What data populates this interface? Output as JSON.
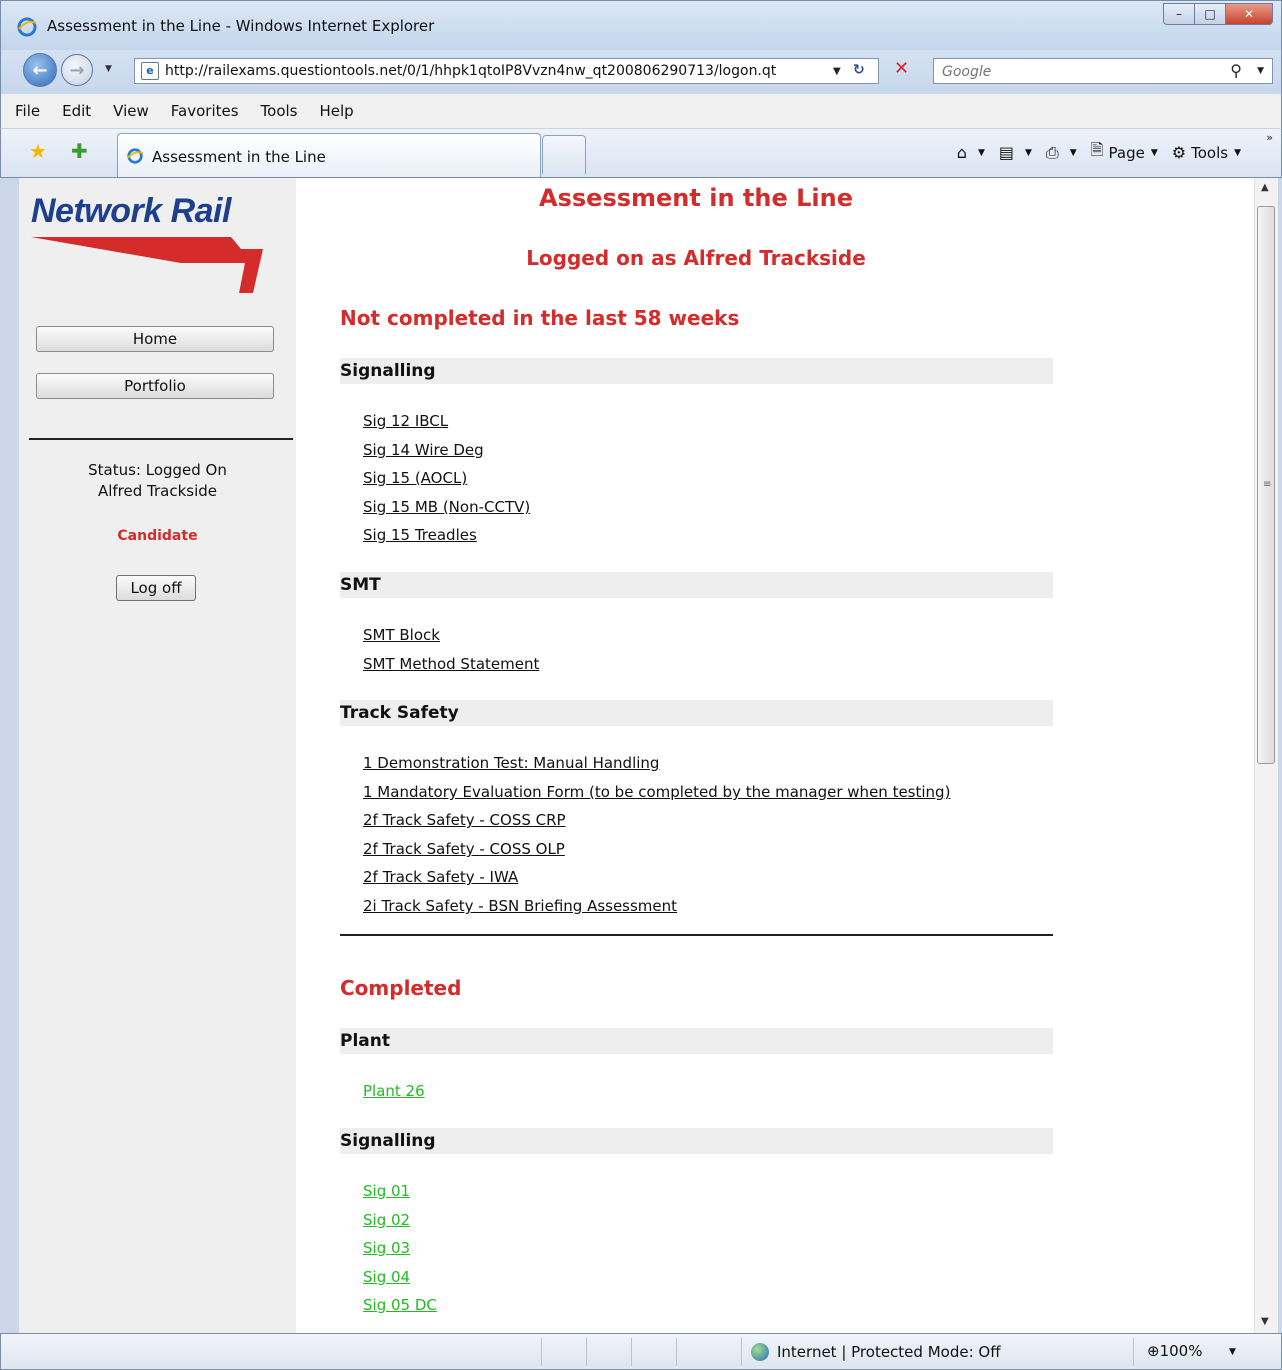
{
  "window": {
    "title": "Assessment in the Line - Windows Internet Explorer",
    "minimize_icon": "minimize-icon",
    "maximize_icon": "maximize-icon",
    "close_icon": "close-icon"
  },
  "address_bar": {
    "url": "http://railexams.questiontools.net/0/1/hhpk1qtoIP8Vvzn4nw_qt200806290713/logon.qt",
    "search_placeholder": "Google"
  },
  "menu": [
    "File",
    "Edit",
    "View",
    "Favorites",
    "Tools",
    "Help"
  ],
  "tab": {
    "label": "Assessment in the Line"
  },
  "command_bar": {
    "page_label": "Page",
    "tools_label": "Tools"
  },
  "sidebar": {
    "logo_text": "Network Rail",
    "home_label": "Home",
    "portfolio_label": "Portfolio",
    "status_line1": "Status: Logged On",
    "status_line2": "Alfred Trackside",
    "role": "Candidate",
    "logoff_label": "Log off"
  },
  "main": {
    "title": "Assessment in the Line",
    "logged_on": "Logged on as Alfred Trackside",
    "not_completed_heading": "Not completed in the last 58 weeks",
    "not_completed": [
      {
        "category": "Signalling",
        "items": [
          "Sig 12 IBCL",
          "Sig 14 Wire Deg",
          "Sig 15 (AOCL)",
          "Sig 15 MB (Non-CCTV)",
          "Sig 15 Treadles"
        ]
      },
      {
        "category": "SMT",
        "items": [
          "SMT Block",
          "SMT Method Statement"
        ]
      },
      {
        "category": "Track Safety",
        "items": [
          "1 Demonstration Test: Manual Handling",
          "1 Mandatory Evaluation Form (to be completed by the manager when testing)",
          "2f Track Safety - COSS CRP",
          "2f Track Safety - COSS OLP",
          "2f Track Safety - IWA",
          "2i Track Safety - BSN Briefing Assessment"
        ]
      }
    ],
    "completed_heading": "Completed",
    "completed": [
      {
        "category": "Plant",
        "items": [
          "Plant 26"
        ]
      },
      {
        "category": "Signalling",
        "items": [
          "Sig 01",
          "Sig 02",
          "Sig 03",
          "Sig 04",
          "Sig 05 DC"
        ]
      }
    ]
  },
  "status_bar": {
    "zone": "Internet | Protected Mode: Off",
    "zoom": "100%"
  },
  "colors": {
    "accent_red": "#d42b2b",
    "completed_green": "#22bb22",
    "brand_blue": "#1d3f8c"
  }
}
